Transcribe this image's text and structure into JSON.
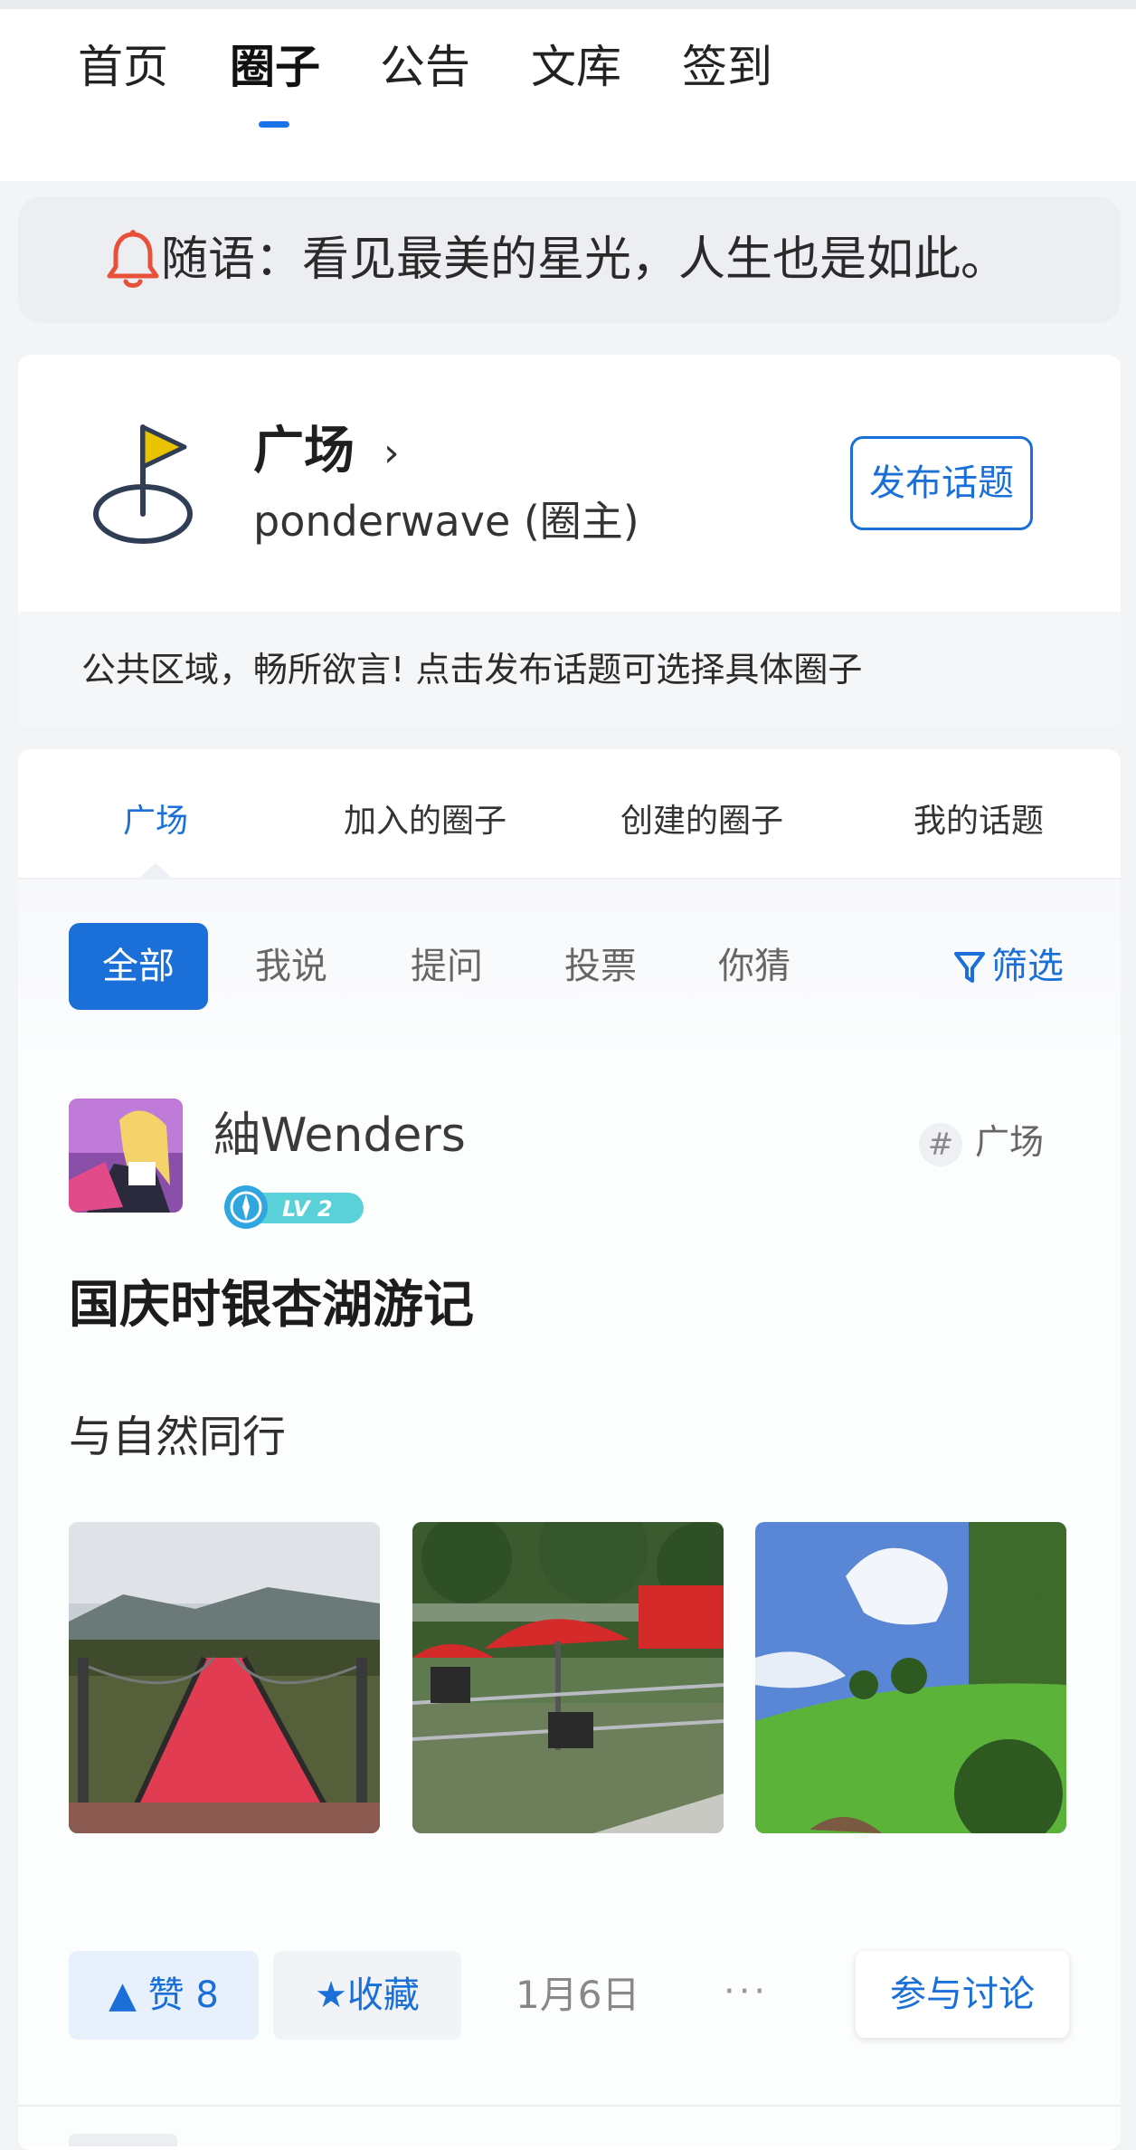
{
  "top_nav": {
    "items": [
      {
        "label": "首页",
        "active": false
      },
      {
        "label": "圈子",
        "active": true
      },
      {
        "label": "公告",
        "active": false
      },
      {
        "label": "文库",
        "active": false
      },
      {
        "label": "签到",
        "active": false
      }
    ]
  },
  "notice": {
    "icon": "bell-icon",
    "text": "随语：看见最美的星光，人生也是如此。"
  },
  "circle": {
    "icon": "flag-icon",
    "name": "广场",
    "chevron": "›",
    "owner": "ponderwave (圈主)",
    "publish_label": "发布话题",
    "description": "公共区域，畅所欲言! 点击发布话题可选择具体圈子"
  },
  "feed_tabs": [
    {
      "label": "广场",
      "active": true
    },
    {
      "label": "加入的圈子",
      "active": false
    },
    {
      "label": "创建的圈子",
      "active": false
    },
    {
      "label": "我的话题",
      "active": false
    }
  ],
  "filter_chips": [
    {
      "label": "全部",
      "active": true
    },
    {
      "label": "我说",
      "active": false
    },
    {
      "label": "提问",
      "active": false
    },
    {
      "label": "投票",
      "active": false
    },
    {
      "label": "你猜",
      "active": false
    }
  ],
  "filter_label": "筛选",
  "post": {
    "author": "紬Wenders",
    "level": "LV 2",
    "tag": "广场",
    "title": "国庆时银杏湖游记",
    "subtitle": "与自然同行",
    "photos": [
      "suspension-bridge-photo",
      "red-umbrella-tents-photo",
      "green-lawn-sky-photo"
    ],
    "like_label": "赞 8",
    "favorite_label": "收藏",
    "date": "1月6日",
    "more": "···",
    "discuss_label": "参与讨论"
  },
  "colors": {
    "accent": "#1a6fd8",
    "bell": "#e8503a",
    "flag": "#e8c400"
  }
}
